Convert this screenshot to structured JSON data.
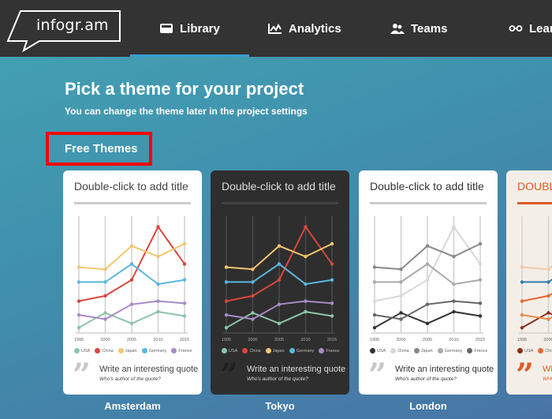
{
  "app": {
    "logo_text": "infogr.am"
  },
  "nav": {
    "items": [
      {
        "label": "Library",
        "icon": "inbox-tray-icon",
        "active": true
      },
      {
        "label": "Analytics",
        "icon": "line-chart-icon",
        "active": false
      },
      {
        "label": "Teams",
        "icon": "users-icon",
        "active": false
      },
      {
        "label": "Learn",
        "icon": "glasses-icon",
        "active": false
      }
    ]
  },
  "page": {
    "title": "Pick a theme for your project",
    "subtitle": "You can change the theme later in the project settings",
    "section_label": "Free Themes",
    "highlight_color": "#ff0000"
  },
  "themes": [
    {
      "name": "Amsterdam",
      "title": "Double-click to add title",
      "quote": "Write an interesting quote",
      "author": "Who's author of the quote?",
      "bg": "#ffffff",
      "text": "#444444",
      "rule": "#cccccc",
      "grid": "#d0d0d0",
      "quote_mark": "#c8c8c8",
      "colors": [
        "#8cc4ab",
        "#d9463e",
        "#f2c66d",
        "#5ab7e0",
        "#a68bc5"
      ]
    },
    {
      "name": "Tokyo",
      "title": "Double-click to add title",
      "quote": "Write an interesting quote",
      "author": "Who's author of the quote?",
      "bg": "#2e2e2e",
      "text": "#dddddd",
      "rule": "#444444",
      "grid": "#4a4a4a",
      "quote_mark": "#1f1f1f",
      "colors": [
        "#8cc4ab",
        "#d9463e",
        "#f2c66d",
        "#5ab7e0",
        "#a68bc5"
      ]
    },
    {
      "name": "London",
      "title": "Double-click to add title",
      "quote": "Write an interesting quote",
      "author": "Who's author of the quote?",
      "bg": "#ffffff",
      "text": "#333333",
      "rule": "#cccccc",
      "grid": "#d0d0d0",
      "quote_mark": "#c8c8c8",
      "colors": [
        "#333333",
        "#d8d8d8",
        "#888888",
        "#aaaaaa",
        "#666666"
      ]
    },
    {
      "name": "",
      "title": "DOUBLE-CLICK TO ADD TITLE",
      "quote": "WRITE AN INTERESTING QUOTE",
      "author": "WHO'S AUTHOR OF THE QUOTE?",
      "bg": "#f3efe8",
      "text": "#e05a2a",
      "rule": "#e05a2a",
      "grid": "#d8d3cc",
      "quote_mark": "#e05a2a",
      "colors": [
        "#8b2e1a",
        "#e8692f",
        "#f0c8a8",
        "#2f7fad",
        "#e88a4a"
      ]
    }
  ],
  "chart_data": {
    "type": "line",
    "x": [
      "1995",
      "2000",
      "2005",
      "2010",
      "2015"
    ],
    "series": [
      {
        "name": "USA",
        "values": [
          5,
          19,
          9,
          20,
          16
        ]
      },
      {
        "name": "China",
        "values": [
          30,
          35,
          50,
          100,
          65
        ]
      },
      {
        "name": "Japan",
        "values": [
          62,
          60,
          82,
          72,
          84
        ]
      },
      {
        "name": "Germany",
        "values": [
          48,
          48,
          65,
          46,
          50
        ]
      },
      {
        "name": "France",
        "values": [
          17,
          13,
          27,
          30,
          28
        ]
      }
    ],
    "legend": [
      "USA",
      "China",
      "Japan",
      "Germany",
      "France"
    ],
    "legend_position": "bottom",
    "grid": true,
    "ylim": [
      0,
      110
    ]
  }
}
